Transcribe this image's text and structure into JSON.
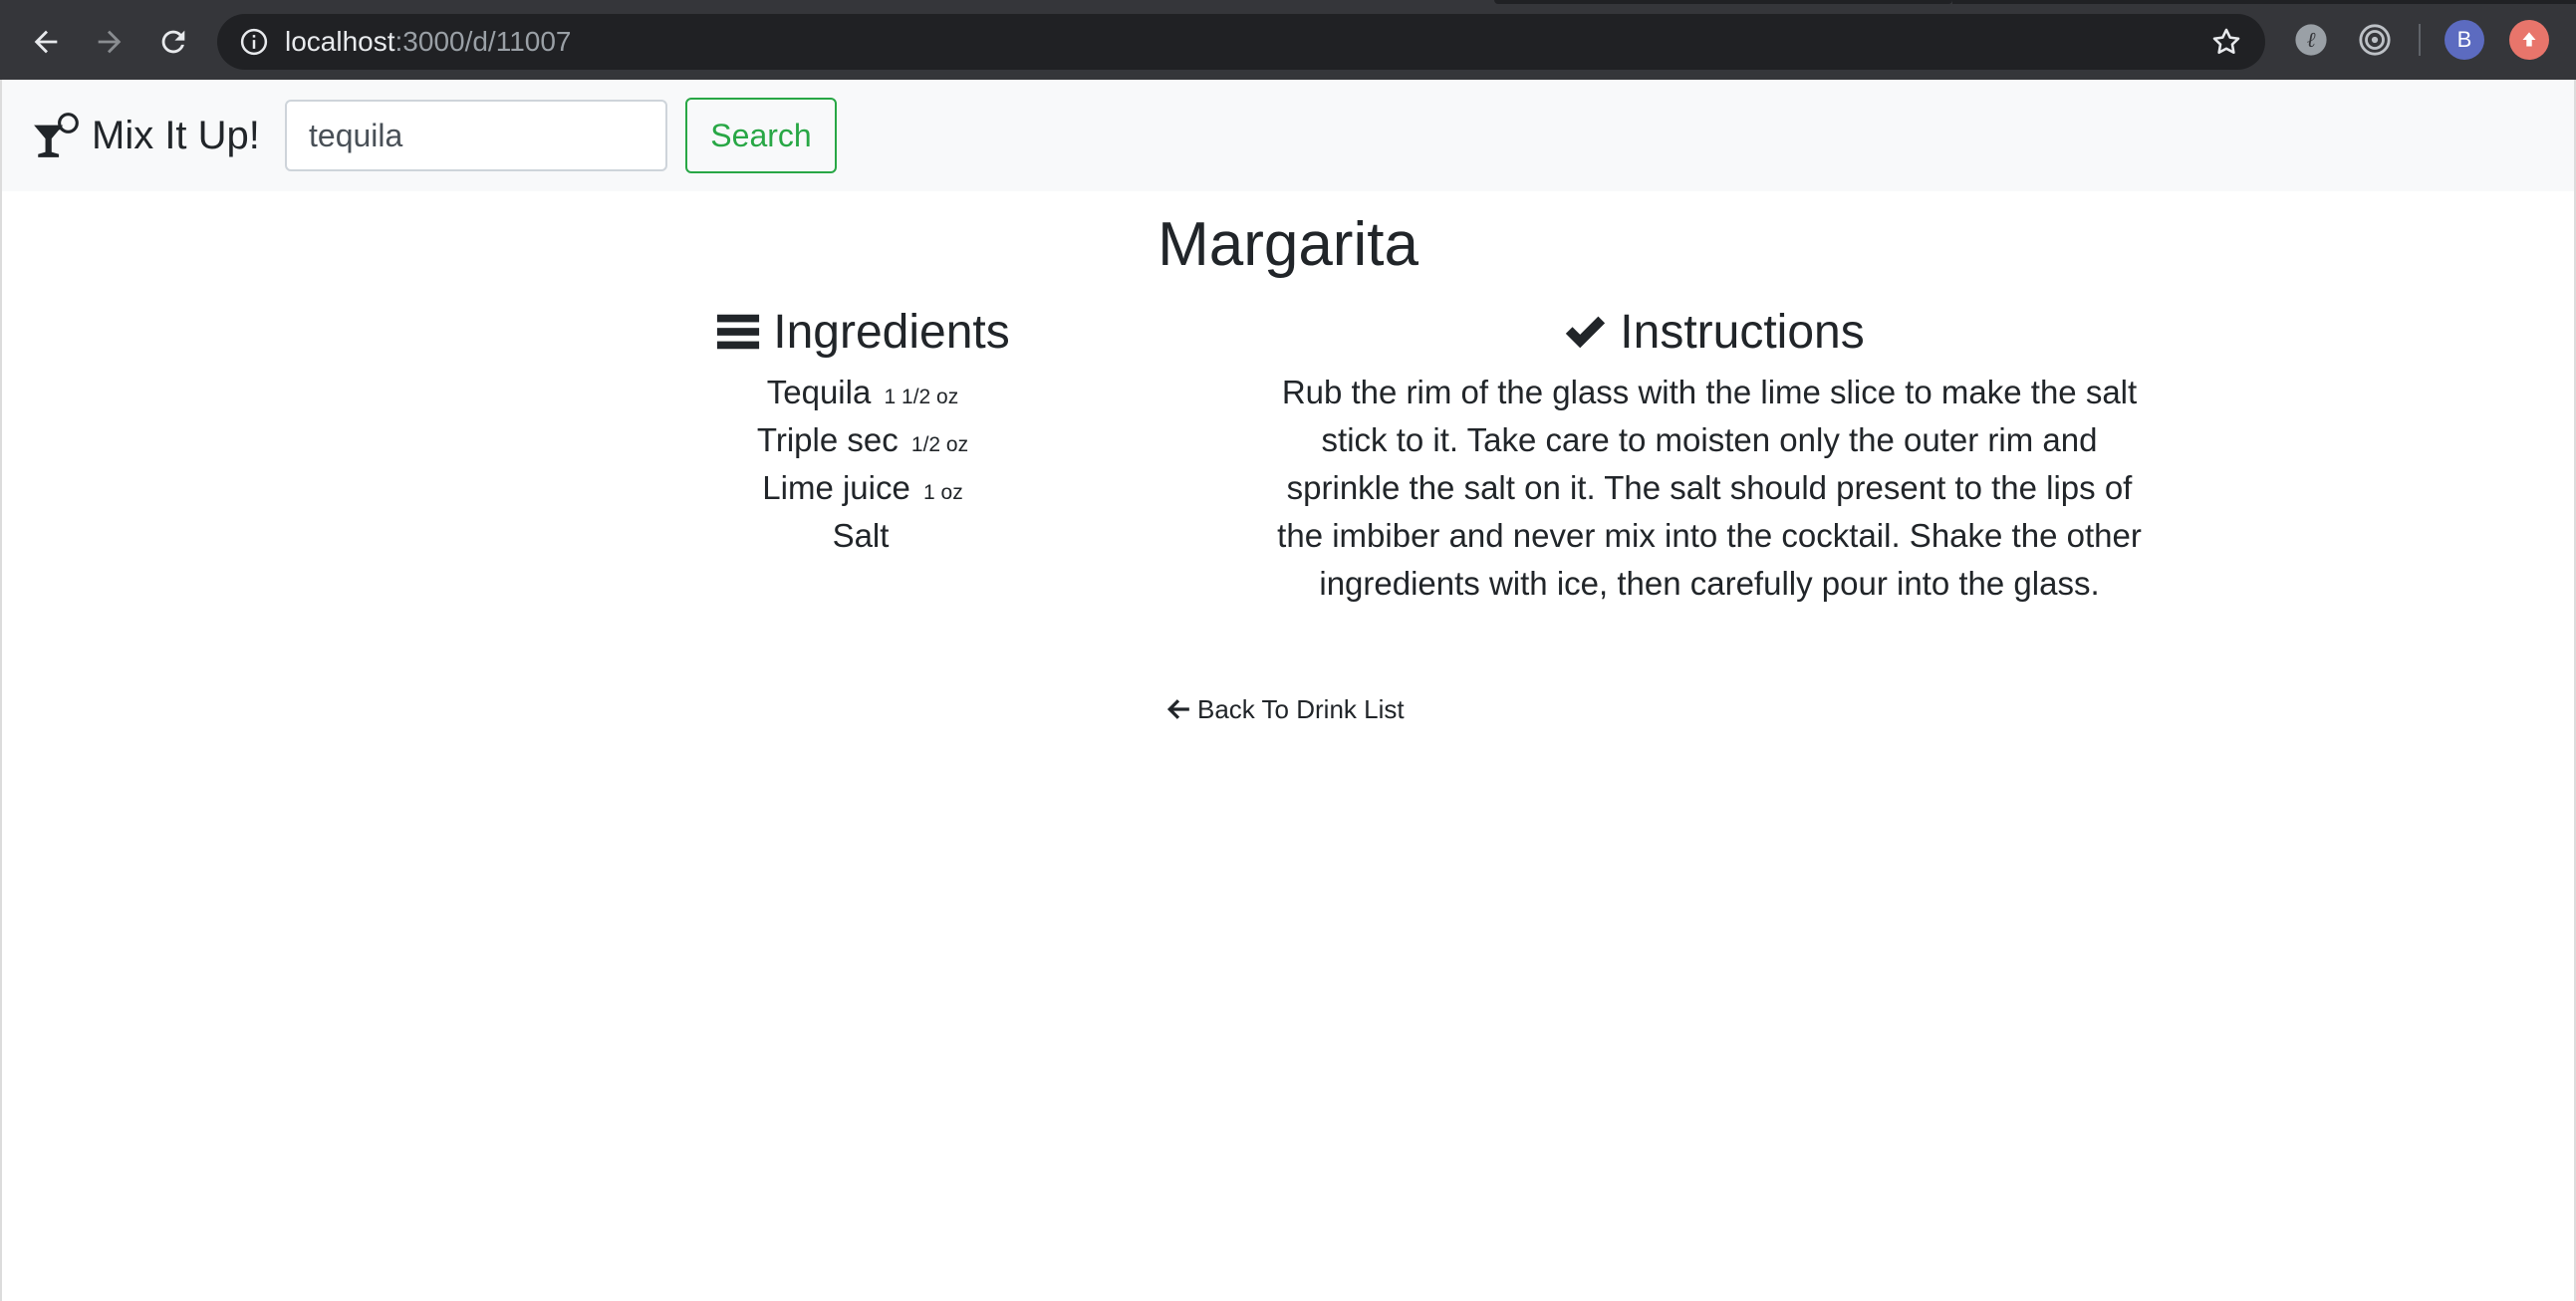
{
  "browser": {
    "url_host": "localhost",
    "url_path": ":3000/d/11007",
    "avatar_letter": "B"
  },
  "navbar": {
    "brand": "Mix It Up!",
    "search_value": "tequila",
    "search_button": "Search"
  },
  "drink": {
    "name": "Margarita",
    "ingredients_heading": "Ingredients",
    "instructions_heading": "Instructions",
    "ingredients": [
      {
        "name": "Tequila",
        "amount": "1 1/2 oz"
      },
      {
        "name": "Triple sec",
        "amount": "1/2 oz"
      },
      {
        "name": "Lime juice",
        "amount": "1 oz"
      },
      {
        "name": "Salt",
        "amount": ""
      }
    ],
    "instructions": "Rub the rim of the glass with the lime slice to make the salt stick to it. Take care to moisten only the outer rim and sprinkle the salt on it. The salt should present to the lips of the imbiber and never mix into the cocktail. Shake the other ingredients with ice, then carefully pour into the glass."
  },
  "back_link": "Back To Drink List",
  "icons": {
    "brand": "cocktail-icon",
    "ingredients": "bars-icon",
    "instructions": "check-icon",
    "back": "arrow-left-icon"
  },
  "colors": {
    "success": "#28a745",
    "navbar_bg": "#f8f9fa",
    "chrome_bg": "#35363a",
    "text": "#212529"
  }
}
